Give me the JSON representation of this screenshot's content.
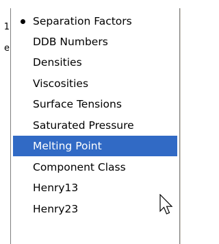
{
  "background_fragments": [
    "1",
    "e"
  ],
  "menu": {
    "items": [
      {
        "label": "Separation Factors",
        "checked": true,
        "selected": false
      },
      {
        "label": "DDB Numbers",
        "checked": false,
        "selected": false
      },
      {
        "label": "Densities",
        "checked": false,
        "selected": false
      },
      {
        "label": "Viscosities",
        "checked": false,
        "selected": false
      },
      {
        "label": "Surface Tensions",
        "checked": false,
        "selected": false
      },
      {
        "label": "Saturated Pressure",
        "checked": false,
        "selected": false
      },
      {
        "label": "Melting Point",
        "checked": false,
        "selected": true
      },
      {
        "label": "Component Class",
        "checked": false,
        "selected": false
      },
      {
        "label": "Henry13",
        "checked": false,
        "selected": false
      },
      {
        "label": "Henry23",
        "checked": false,
        "selected": false
      }
    ]
  },
  "colors": {
    "selection": "#316ac5",
    "selection_text": "#ffffff",
    "text": "#000000"
  },
  "icons": {
    "check": "bullet-icon",
    "pointer": "mouse-pointer-icon"
  }
}
